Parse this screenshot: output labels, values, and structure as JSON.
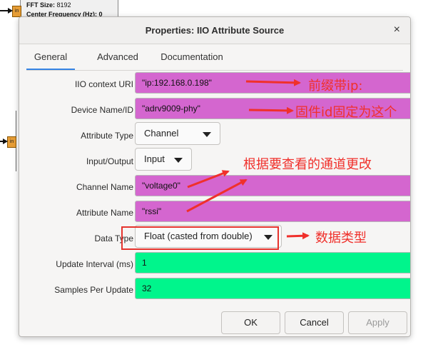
{
  "background": {
    "block_line1_label": "FFT Size:",
    "block_line1_value": "8192",
    "block_line2": "Center Frequency (Hz): 0",
    "port_top": "in",
    "port_left": "in"
  },
  "dialog": {
    "title": "Properties: IIO Attribute Source",
    "close_glyph": "×",
    "tabs": [
      {
        "label": "General"
      },
      {
        "label": "Advanced"
      },
      {
        "label": "Documentation"
      }
    ],
    "active_tab": "General",
    "fields": {
      "context_uri": {
        "label": "IIO context URI",
        "value": "\"ip:192.168.0.198\""
      },
      "device_name": {
        "label": "Device Name/ID",
        "value": "\"adrv9009-phy\""
      },
      "attribute_type": {
        "label": "Attribute Type",
        "value": "Channel"
      },
      "input_output": {
        "label": "Input/Output",
        "value": "Input"
      },
      "channel_name": {
        "label": "Channel Name",
        "value": "\"voltage0\""
      },
      "attribute_name": {
        "label": "Attribute Name",
        "value": "\"rssi\""
      },
      "data_type": {
        "label": "Data Type",
        "value": "Float (casted from double)"
      },
      "update_interval": {
        "label": "Update Interval (ms)",
        "value": "1"
      },
      "samples_per_update": {
        "label": "Samples Per Update",
        "value": "32"
      }
    },
    "buttons": {
      "ok": "OK",
      "cancel": "Cancel",
      "apply": "Apply"
    }
  },
  "annotations": {
    "prefix_ip": "前缀带ip:",
    "firmware_id": "固件id固定为这个",
    "channel_change": "根据要查看的通道更改",
    "data_type": "数据类型"
  },
  "colors": {
    "string_field": "#d466cf",
    "number_field": "#00f58c",
    "annotation_red": "#f0302b",
    "tab_accent": "#3584e4"
  }
}
